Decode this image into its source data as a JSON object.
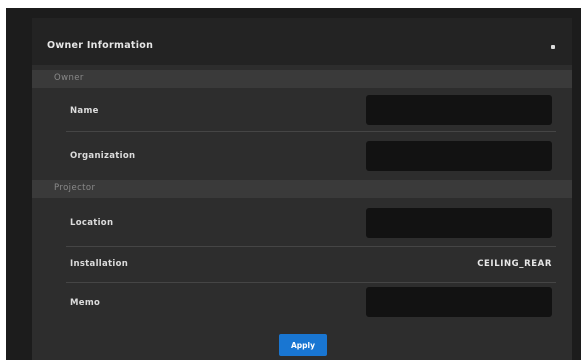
{
  "panel": {
    "title": "Owner Information",
    "collapse_icon": "collapse-dot-icon"
  },
  "owner_section": {
    "label": "Owner",
    "fields": {
      "name": {
        "label": "Name",
        "value": ""
      },
      "organization": {
        "label": "Organization",
        "value": ""
      }
    }
  },
  "projector_section": {
    "label": "Projector",
    "fields": {
      "location": {
        "label": "Location",
        "value": ""
      },
      "installation": {
        "label": "Installation",
        "value": "CEILING_REAR"
      },
      "memo": {
        "label": "Memo",
        "value": ""
      }
    }
  },
  "actions": {
    "apply_label": "Apply"
  },
  "colors": {
    "background": "#1c1c1c",
    "panel": "#2d2d2d",
    "header": "#232323",
    "section_header": "#3a3a3a",
    "input": "#121212",
    "accent": "#1976d2"
  }
}
